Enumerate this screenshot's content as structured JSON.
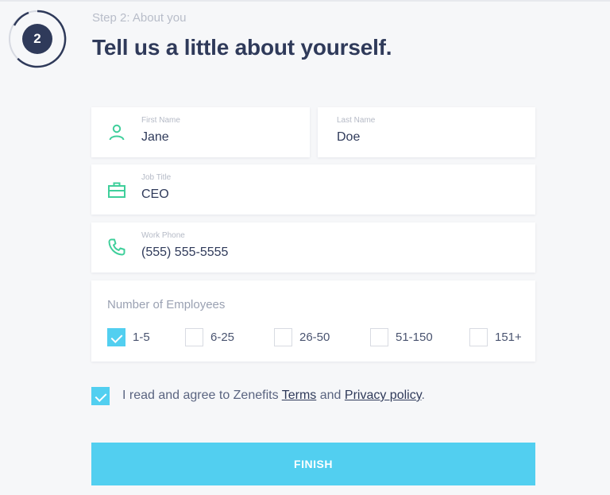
{
  "step": {
    "number": "2",
    "label": "Step 2: About you"
  },
  "title": "Tell us a little about yourself.",
  "fields": {
    "first_name": {
      "label": "First Name",
      "value": "Jane",
      "icon": "person-icon"
    },
    "last_name": {
      "label": "Last Name",
      "value": "Doe"
    },
    "job_title": {
      "label": "Job Title",
      "value": "CEO",
      "icon": "briefcase-icon"
    },
    "work_phone": {
      "label": "Work Phone",
      "value": "(555) 555-5555",
      "icon": "phone-icon"
    }
  },
  "employees": {
    "title": "Number of Employees",
    "options": [
      {
        "label": "1-5",
        "checked": true
      },
      {
        "label": "6-25",
        "checked": false
      },
      {
        "label": "26-50",
        "checked": false
      },
      {
        "label": "51-150",
        "checked": false
      },
      {
        "label": "151+",
        "checked": false
      }
    ]
  },
  "agreement": {
    "checked": true,
    "prefix": "I read and agree to Zenefits ",
    "terms_link": "Terms",
    "middle": " and ",
    "privacy_link": "Privacy policy",
    "suffix": "."
  },
  "finish_button": "FINISH",
  "colors": {
    "accent": "#52cff0",
    "icon_green": "#3fcf9b",
    "dark_navy": "#2f3a5a",
    "background": "#f6f7f9"
  }
}
